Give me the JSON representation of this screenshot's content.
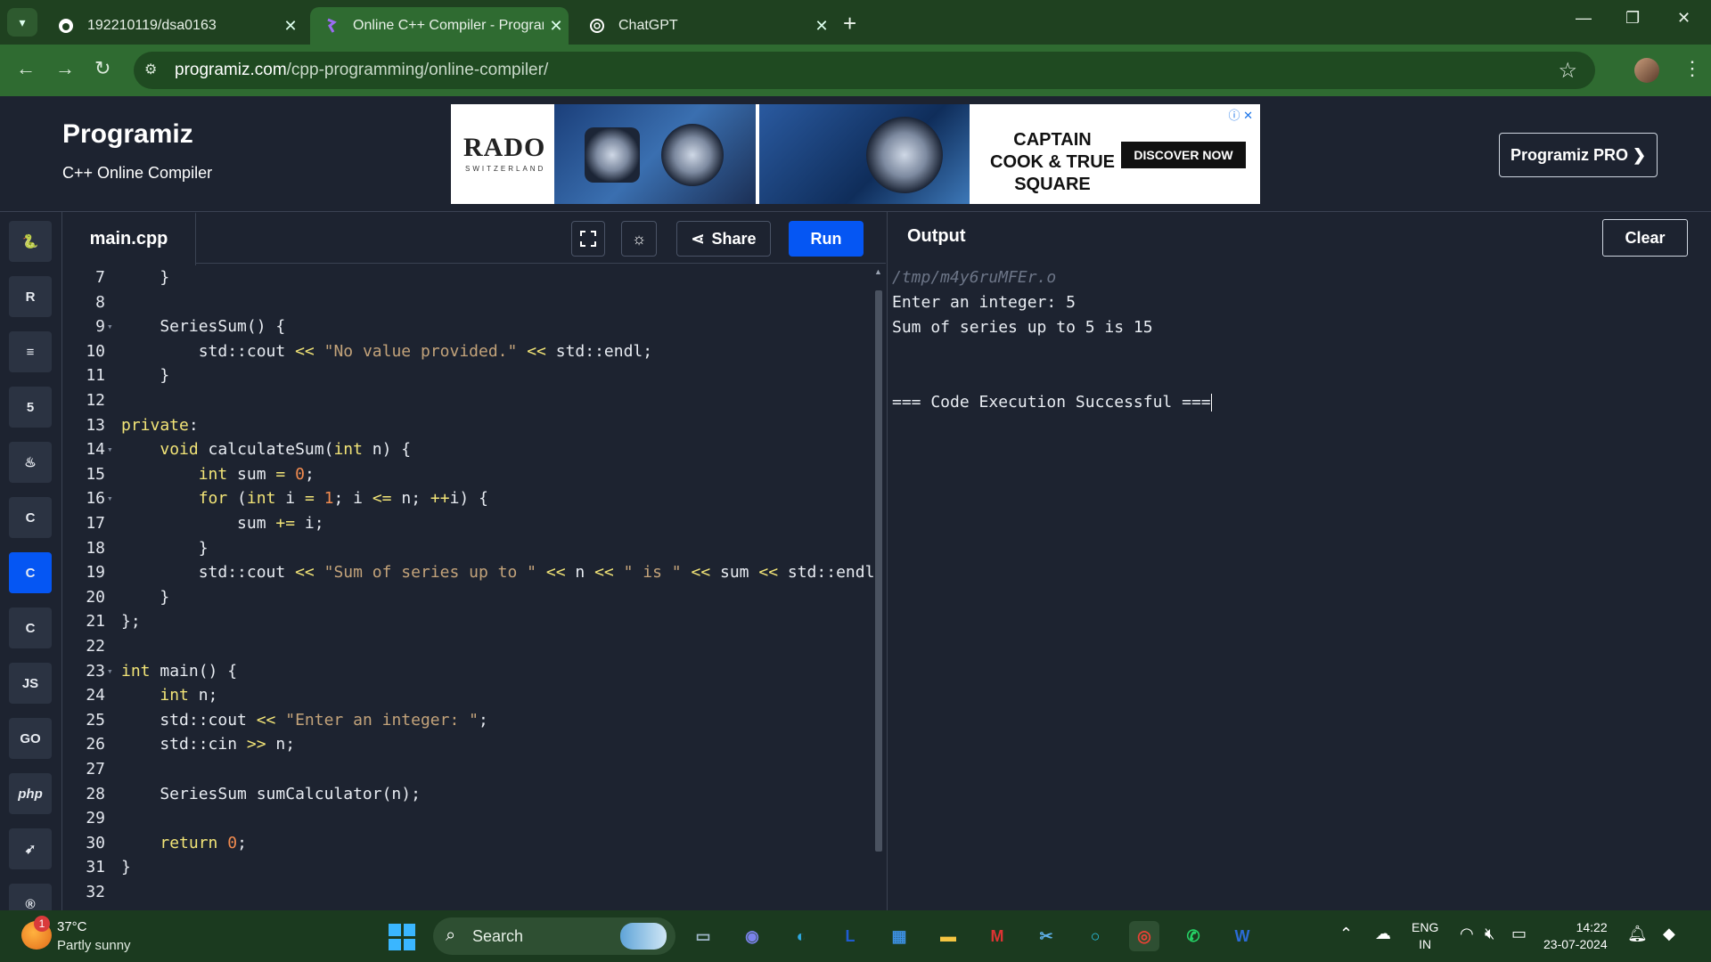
{
  "browser": {
    "tabs": [
      {
        "title": "192210119/dsa0163",
        "icon": "github-icon",
        "active": false
      },
      {
        "title": "Online C++ Compiler - Program",
        "icon": "programiz-icon",
        "active": true
      },
      {
        "title": "ChatGPT",
        "icon": "chatgpt-icon",
        "active": false
      }
    ],
    "new_tab": "+",
    "url_host": "programiz.com",
    "url_path": "/cpp-programming/online-compiler/"
  },
  "header": {
    "logo": "Programiz",
    "subtitle": "C++ Online Compiler",
    "pro_button": "Programiz PRO ❯"
  },
  "ad": {
    "brand": "RADO",
    "brand_sub": "SWITZERLAND",
    "headline": "CAPTAIN COOK & TRUE SQUARE",
    "cta": "DISCOVER NOW"
  },
  "languages": [
    {
      "name": "python-icon",
      "glyph": "🐍",
      "active": false
    },
    {
      "name": "r-icon",
      "glyph": "R",
      "active": false
    },
    {
      "name": "sql-icon",
      "glyph": "≡",
      "active": false
    },
    {
      "name": "html-icon",
      "glyph": "5",
      "active": false
    },
    {
      "name": "java-icon",
      "glyph": "♨",
      "active": false
    },
    {
      "name": "c-icon",
      "glyph": "C",
      "active": false
    },
    {
      "name": "cpp-icon",
      "glyph": "C",
      "active": true
    },
    {
      "name": "csharp-icon",
      "glyph": "C",
      "active": false
    },
    {
      "name": "js-icon",
      "glyph": "JS",
      "active": false
    },
    {
      "name": "go-icon",
      "glyph": "GO",
      "active": false
    },
    {
      "name": "php-icon",
      "glyph": "php",
      "active": false
    },
    {
      "name": "swift-icon",
      "glyph": "➹",
      "active": false
    },
    {
      "name": "rust-icon",
      "glyph": "®",
      "active": false
    }
  ],
  "editor": {
    "file_name": "main.cpp",
    "share_label": "Share",
    "run_label": "Run",
    "lines": [
      {
        "n": "7",
        "fold": false,
        "code": "    }"
      },
      {
        "n": "8",
        "fold": false,
        "code": ""
      },
      {
        "n": "9",
        "fold": true,
        "code": "    SeriesSum() {"
      },
      {
        "n": "10",
        "fold": false,
        "code": "        std::cout << \"No value provided.\" << std::endl;"
      },
      {
        "n": "11",
        "fold": false,
        "code": "    }"
      },
      {
        "n": "12",
        "fold": false,
        "code": ""
      },
      {
        "n": "13",
        "fold": false,
        "code": "private:"
      },
      {
        "n": "14",
        "fold": true,
        "code": "    void calculateSum(int n) {"
      },
      {
        "n": "15",
        "fold": false,
        "code": "        int sum = 0;"
      },
      {
        "n": "16",
        "fold": true,
        "code": "        for (int i = 1; i <= n; ++i) {"
      },
      {
        "n": "17",
        "fold": false,
        "code": "            sum += i;"
      },
      {
        "n": "18",
        "fold": false,
        "code": "        }"
      },
      {
        "n": "19",
        "fold": false,
        "code": "        std::cout << \"Sum of series up to \" << n << \" is \" << sum << std::endl;"
      },
      {
        "n": "20",
        "fold": false,
        "code": "    }"
      },
      {
        "n": "21",
        "fold": false,
        "code": "};"
      },
      {
        "n": "22",
        "fold": false,
        "code": ""
      },
      {
        "n": "23",
        "fold": true,
        "code": "int main() {"
      },
      {
        "n": "24",
        "fold": false,
        "code": "    int n;"
      },
      {
        "n": "25",
        "fold": false,
        "code": "    std::cout << \"Enter an integer: \";"
      },
      {
        "n": "26",
        "fold": false,
        "code": "    std::cin >> n;"
      },
      {
        "n": "27",
        "fold": false,
        "code": ""
      },
      {
        "n": "28",
        "fold": false,
        "code": "    SeriesSum sumCalculator(n);"
      },
      {
        "n": "29",
        "fold": false,
        "code": ""
      },
      {
        "n": "30",
        "fold": false,
        "code": "    return 0;"
      },
      {
        "n": "31",
        "fold": false,
        "code": "}"
      },
      {
        "n": "32",
        "fold": false,
        "code": ""
      }
    ]
  },
  "output": {
    "title": "Output",
    "clear_label": "Clear",
    "lines": [
      {
        "text": "/tmp/m4y6ruMFEr.o",
        "kind": "path"
      },
      {
        "text": "Enter an integer: 5",
        "kind": "normal"
      },
      {
        "text": "Sum of series up to 5 is 15",
        "kind": "normal"
      },
      {
        "text": "",
        "kind": "normal"
      },
      {
        "text": "",
        "kind": "normal"
      },
      {
        "text": "=== Code Execution Successful ===",
        "kind": "normal"
      }
    ]
  },
  "taskbar": {
    "temperature": "37°C",
    "condition": "Partly sunny",
    "weather_badge": "1",
    "search_label": "Search",
    "language_line1": "ENG",
    "language_line2": "IN",
    "time": "14:22",
    "date": "23-07-2024",
    "apps": [
      {
        "name": "task-view-icon",
        "glyph": "▭"
      },
      {
        "name": "teams-icon",
        "glyph": "◉"
      },
      {
        "name": "edge-icon",
        "glyph": "◐"
      },
      {
        "name": "l-app-icon",
        "glyph": "L"
      },
      {
        "name": "store-icon",
        "glyph": "▦"
      },
      {
        "name": "file-explorer-icon",
        "glyph": "▬"
      },
      {
        "name": "mcafee-icon",
        "glyph": "M"
      },
      {
        "name": "snipping-tool-icon",
        "glyph": "✂"
      },
      {
        "name": "cortana-icon",
        "glyph": "○"
      },
      {
        "name": "chrome-icon",
        "glyph": "◎"
      },
      {
        "name": "whatsapp-icon",
        "glyph": "✆"
      },
      {
        "name": "word-icon",
        "glyph": "W"
      }
    ]
  },
  "colors": {
    "run_button": "#0556f3",
    "keyword": "#f2e477",
    "string": "#c3a37a",
    "number": "#f18b4f",
    "editor_bg": "#1d2330"
  }
}
